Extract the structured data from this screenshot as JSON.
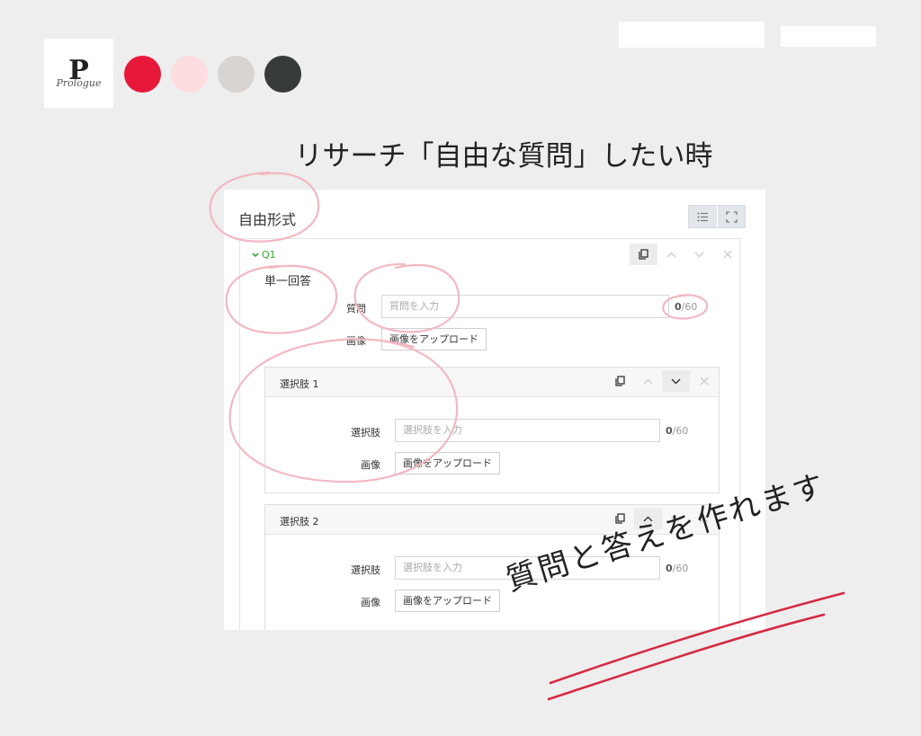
{
  "brand": {
    "logo_letter": "P",
    "logo_script": "Prologue",
    "swatches": [
      "#e8183a",
      "#fddde0",
      "#d8d4d2",
      "#373a3b"
    ]
  },
  "headline": "リサーチ「自由な質問」したい時",
  "panel": {
    "title": "自由形式",
    "toolbar": {
      "list_icon": "list-icon",
      "expand_icon": "fullscreen-icon"
    }
  },
  "question": {
    "label": "Q1",
    "type": "単一回答",
    "question_label": "質問",
    "question_placeholder": "質問を入力",
    "counter_current": "0",
    "counter_max": "/60",
    "image_label": "画像",
    "upload_label": "画像をアップロード",
    "choices": [
      {
        "title": "選択肢 1",
        "field_label": "選択肢",
        "placeholder": "選択肢を入力",
        "counter_current": "0",
        "counter_max": "/60",
        "image_label": "画像",
        "upload_label": "画像をアップロード"
      },
      {
        "title": "選択肢 2",
        "field_label": "選択肢",
        "placeholder": "選択肢を入力",
        "counter_current": "0",
        "counter_max": "/60",
        "image_label": "画像",
        "upload_label": "画像をアップロード"
      }
    ]
  },
  "annotation": {
    "handwritten": "質問と答えを作れます",
    "color": "#f2b8c1",
    "underline_color": "#d62a45"
  }
}
